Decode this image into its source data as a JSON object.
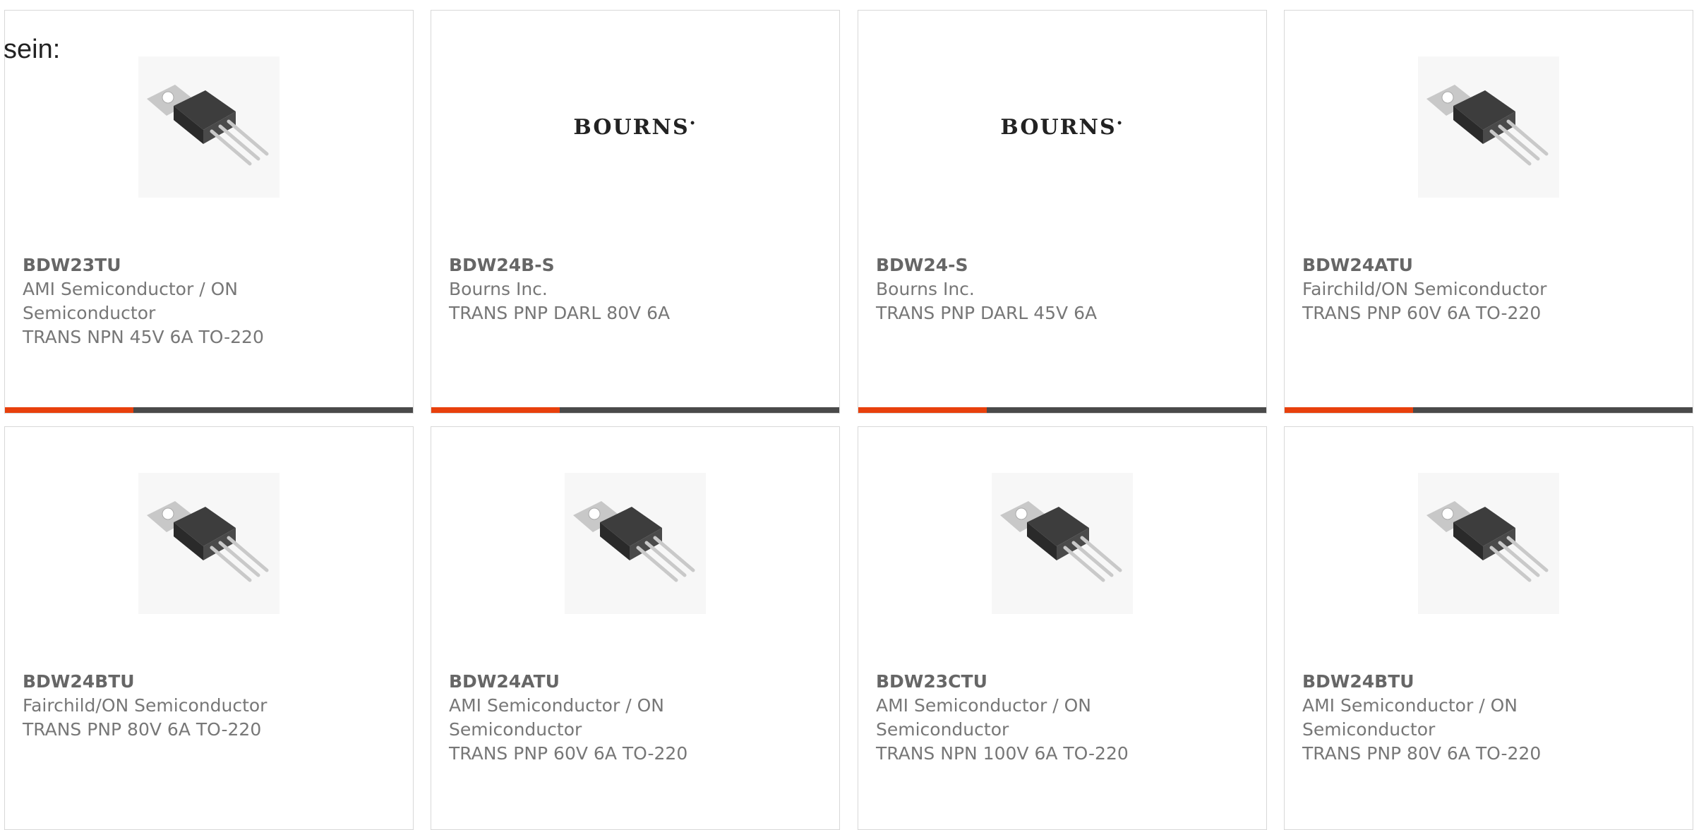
{
  "heading": "sein:",
  "colors": {
    "accent": "#e8400c",
    "bar": "#4a4a4a",
    "text": "#777777"
  },
  "cards": [
    {
      "image": "to-220-transistor-image",
      "part": "BDW23TU",
      "manufacturer": "AMI Semiconductor / ON Semiconductor",
      "description": "TRANS NPN 45V 6A TO-220"
    },
    {
      "image": "bourns-logo",
      "logo_text": "BOURNS",
      "part": "BDW24B-S",
      "manufacturer": "Bourns Inc.",
      "description": "TRANS PNP DARL 80V 6A"
    },
    {
      "image": "bourns-logo",
      "logo_text": "BOURNS",
      "part": "BDW24-S",
      "manufacturer": "Bourns Inc.",
      "description": "TRANS PNP DARL 45V 6A"
    },
    {
      "image": "to-220-transistor-image",
      "part": "BDW24ATU",
      "manufacturer": "Fairchild/ON Semiconductor",
      "description": "TRANS PNP 60V 6A TO-220"
    },
    {
      "image": "to-220-transistor-image",
      "part": "BDW24BTU",
      "manufacturer": "Fairchild/ON Semiconductor",
      "description": "TRANS PNP 80V 6A TO-220"
    },
    {
      "image": "to-220-transistor-image",
      "part": "BDW24ATU",
      "manufacturer": "AMI Semiconductor / ON Semiconductor",
      "description": "TRANS PNP 60V 6A TO-220"
    },
    {
      "image": "to-220-transistor-image",
      "part": "BDW23CTU",
      "manufacturer": "AMI Semiconductor / ON Semiconductor",
      "description": "TRANS NPN 100V 6A TO-220"
    },
    {
      "image": "to-220-transistor-image",
      "part": "BDW24BTU",
      "manufacturer": "AMI Semiconductor / ON Semiconductor",
      "description": "TRANS PNP 80V 6A TO-220"
    }
  ]
}
